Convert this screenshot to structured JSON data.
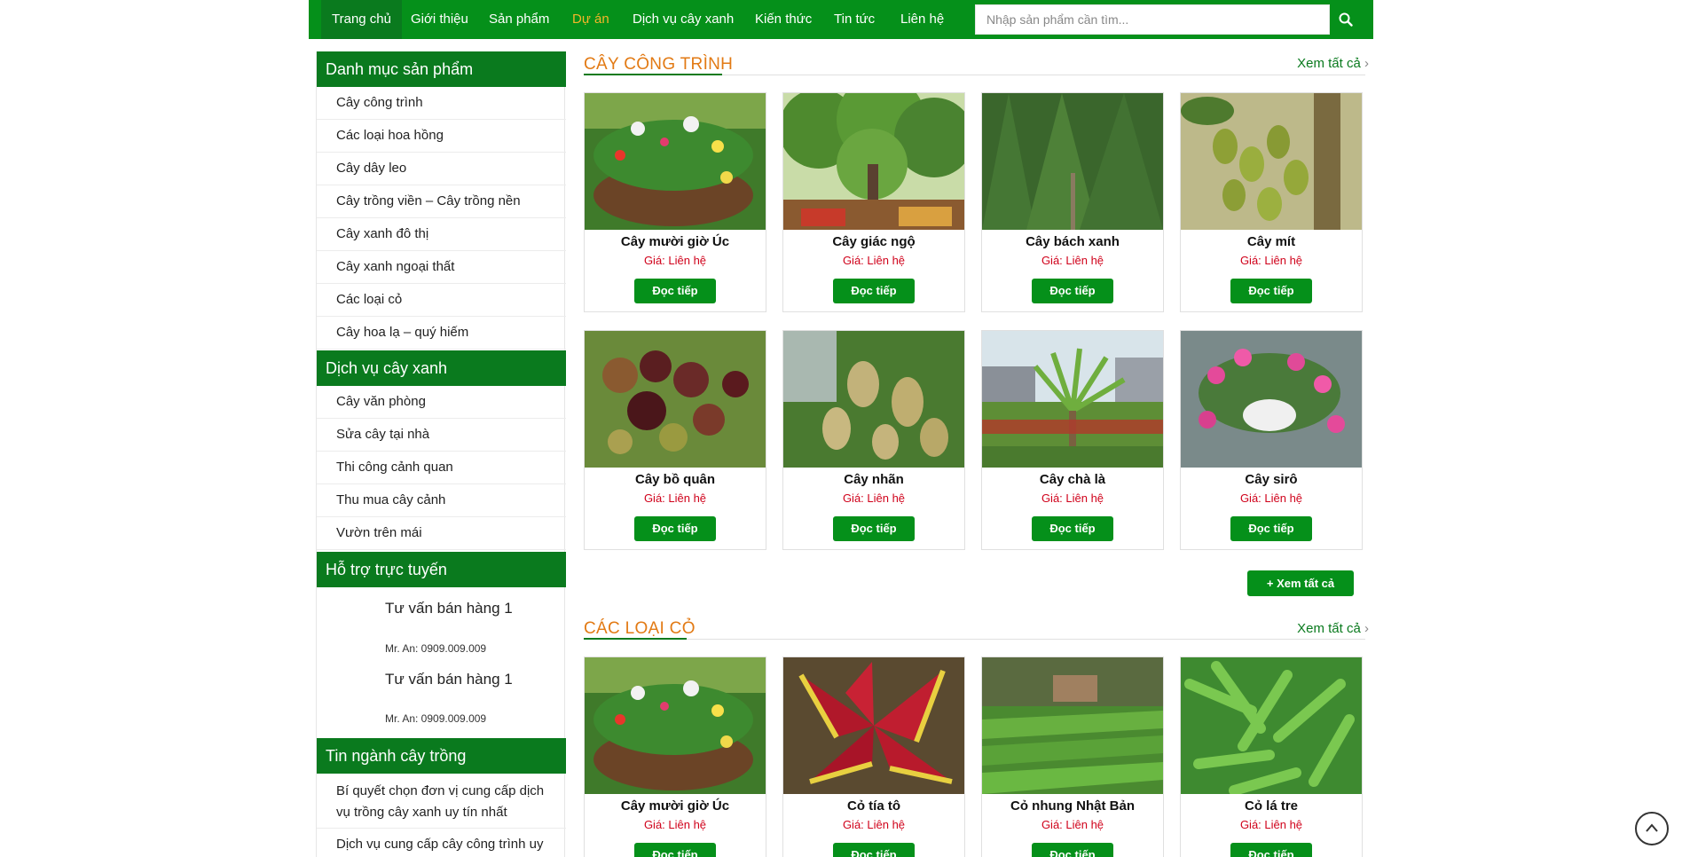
{
  "nav": {
    "items": [
      "Trang chủ",
      "Giới thiệu",
      "Sản phẩm",
      "Dự án",
      "Dịch vụ cây xanh",
      "Kiến thức",
      "Tin tức",
      "Liên hệ"
    ],
    "search_placeholder": "Nhập sản phẩm cần tìm..."
  },
  "sidebar": {
    "categories_title": "Danh mục sản phẩm",
    "categories": [
      "Cây công trình",
      "Các loại hoa hồng",
      "Cây dây leo",
      "Cây trồng viền – Cây trồng nền",
      "Cây xanh đô thị",
      "Cây xanh ngoại thất",
      "Các loại cỏ",
      "Cây hoa lạ – quý hiếm"
    ],
    "services_title": "Dịch vụ cây xanh",
    "services": [
      "Cây văn phòng",
      "Sửa cây tại nhà",
      "Thi công cảnh quan",
      "Thu mua cây cảnh",
      "Vườn trên mái"
    ],
    "support_title": "Hỗ trợ trực tuyến",
    "support": [
      {
        "title": "Tư vấn bán hàng 1",
        "phone": "Mr. An: 0909.009.009"
      },
      {
        "title": "Tư vấn bán hàng 1",
        "phone": "Mr. An: 0909.009.009"
      }
    ],
    "news_title": "Tin ngành cây trồng",
    "news": [
      "Bí quyết chọn đơn vị cung cấp dịch vụ trồng cây xanh uy tín nhất",
      "Dịch vụ cung cấp cây công trình uy tín"
    ]
  },
  "sections": [
    {
      "title": "CÂY CÔNG TRÌNH",
      "see_all": "Xem tất cả",
      "products": [
        {
          "name": "Cây mười giờ Úc",
          "price": "Giá: Liên hệ",
          "button": "Đọc tiếp"
        },
        {
          "name": "Cây giác ngộ",
          "price": "Giá: Liên hệ",
          "button": "Đọc tiếp"
        },
        {
          "name": "Cây bách xanh",
          "price": "Giá: Liên hệ",
          "button": "Đọc tiếp"
        },
        {
          "name": "Cây mít",
          "price": "Giá: Liên hệ",
          "button": "Đọc tiếp"
        },
        {
          "name": "Cây bồ quân",
          "price": "Giá: Liên hệ",
          "button": "Đọc tiếp"
        },
        {
          "name": "Cây nhãn",
          "price": "Giá: Liên hệ",
          "button": "Đọc tiếp"
        },
        {
          "name": "Cây chà là",
          "price": "Giá: Liên hệ",
          "button": "Đọc tiếp"
        },
        {
          "name": "Cây sirô",
          "price": "Giá: Liên hệ",
          "button": "Đọc tiếp"
        }
      ],
      "more_button": "+ Xem tất cả"
    },
    {
      "title": "CÁC LOẠI CỎ",
      "see_all": "Xem tất cả",
      "products": [
        {
          "name": "Cây mười giờ Úc",
          "price": "Giá: Liên hệ",
          "button": "Đọc tiếp"
        },
        {
          "name": "Cỏ tía tô",
          "price": "Giá: Liên hệ",
          "button": "Đọc tiếp"
        },
        {
          "name": "Cỏ nhung Nhật Bản",
          "price": "Giá: Liên hệ",
          "button": "Đọc tiếp"
        },
        {
          "name": "Cỏ lá tre",
          "price": "Giá: Liên hệ",
          "button": "Đọc tiếp"
        }
      ]
    }
  ],
  "colors": {
    "brand_green": "#05901a",
    "dark_green": "#0a7a1e",
    "accent_orange": "#e27a14",
    "price_red": "#d0021b"
  }
}
